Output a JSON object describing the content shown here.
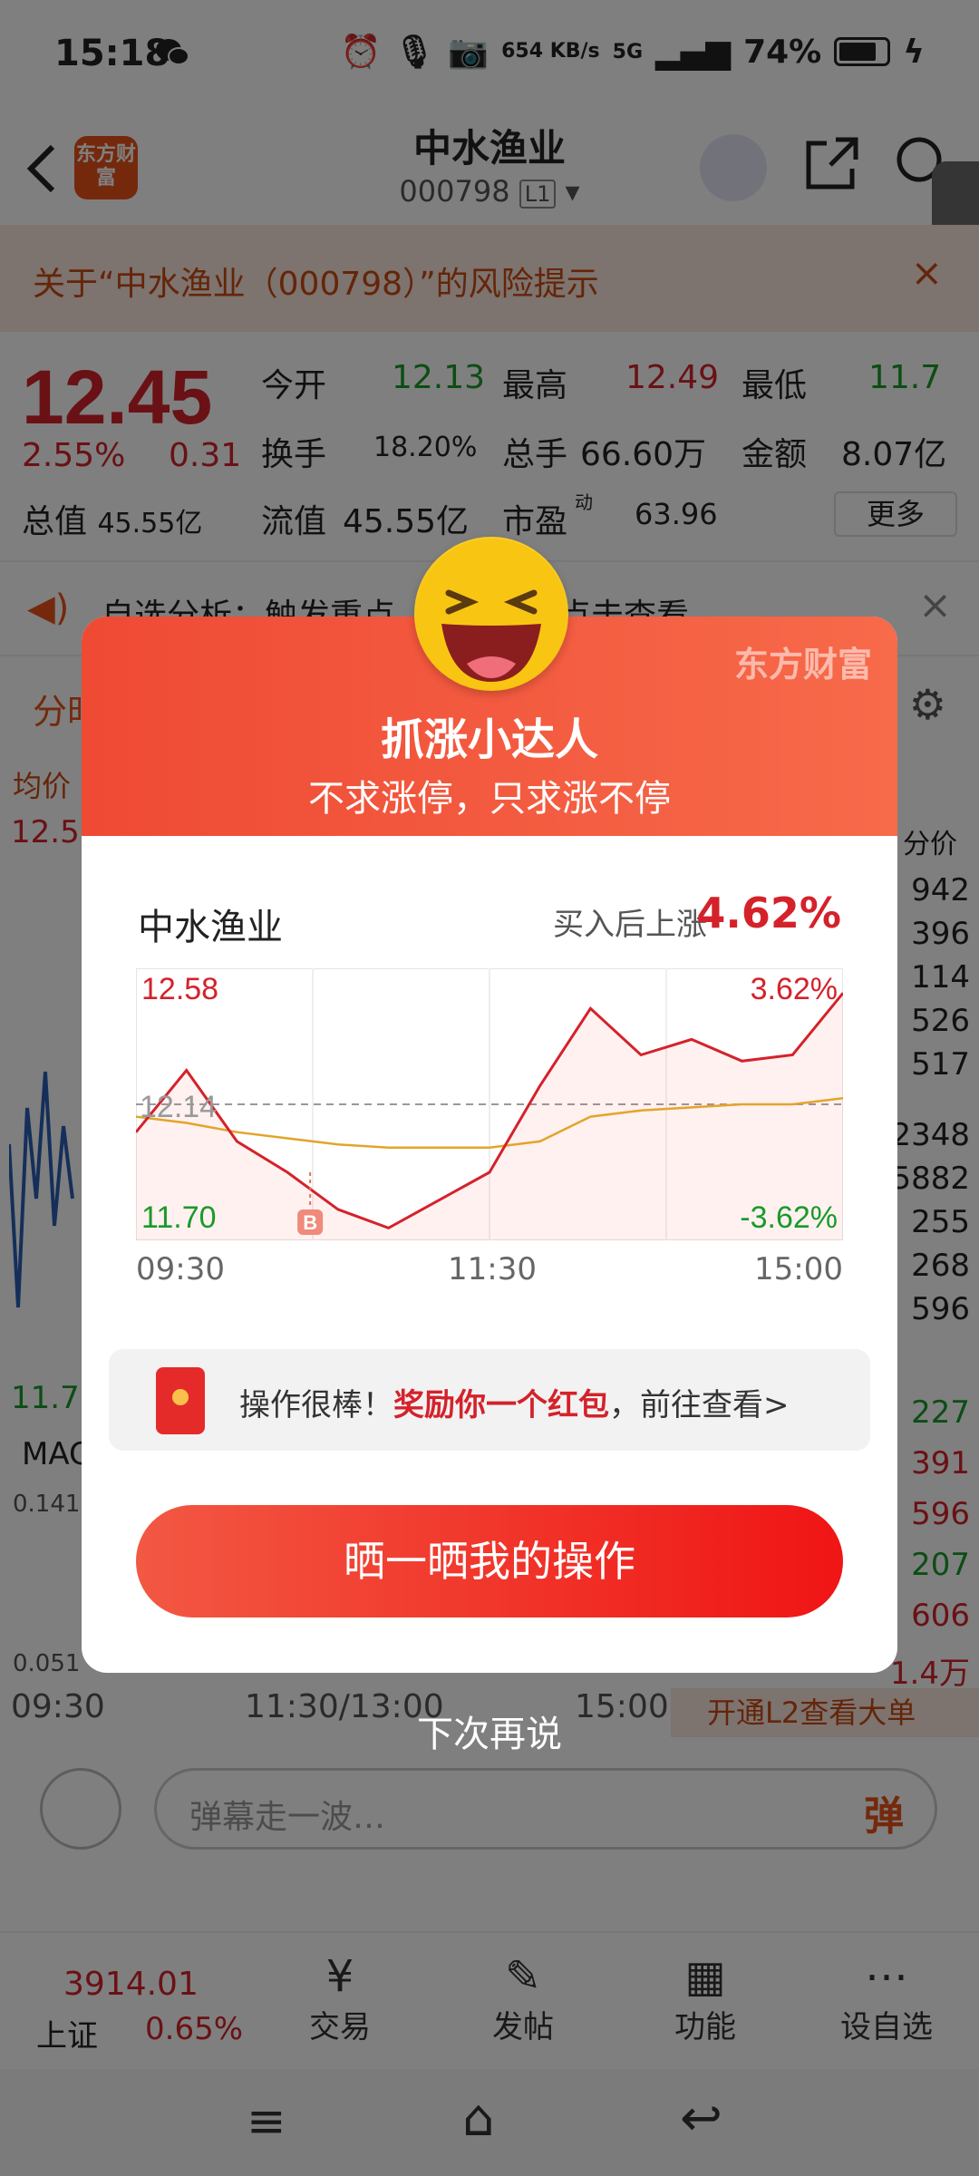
{
  "status_bar": {
    "time": "15:18",
    "net_speed": "654 KB/s",
    "network": "5G",
    "battery": "74%"
  },
  "header": {
    "logo": "东方财富",
    "title": "中水渔业",
    "code": "000798",
    "level": "L1"
  },
  "risk_notice": "关于“中水渔业（000798）”的风险提示",
  "quote": {
    "price": "12.45",
    "change_pct": "2.55%",
    "change": "0.31",
    "total_value_label": "总值",
    "total_value": "45.55亿",
    "open_label": "今开",
    "open": "12.13",
    "high_label": "最高",
    "high": "12.49",
    "low_label": "最低",
    "low": "11.7",
    "turnover_label": "换手",
    "turnover": "18.20%",
    "volume_label": "总手",
    "volume": "66.60万",
    "amount_label": "金额",
    "amount": "8.07亿",
    "float_label": "流值",
    "float_value": "45.55亿",
    "pe_label": "市盈",
    "pe_sup": "动",
    "pe": "63.96",
    "more": "更多"
  },
  "analysis_notice": "自选分析：触发重点……，立即点击查看",
  "tabs": {
    "intraday": "分时"
  },
  "chart_bg": {
    "avg_label": "均价",
    "top_price": "12.58",
    "bottom_price": "11.70",
    "macd_label": "MACD",
    "macd_top": "0.141",
    "macd_bottom": "0.051",
    "times": [
      "09:30",
      "11:30/13:00",
      "15:00"
    ],
    "side_header": "分价",
    "side_values": [
      "942",
      "396",
      "114",
      "526",
      "517",
      "2348",
      "5882",
      "255",
      "268",
      "596",
      "227",
      "391",
      "596",
      "207",
      "606",
      "1.4万"
    ],
    "l2_banner": "开通L2查看大单"
  },
  "danmu": {
    "placeholder": "弹幕走一波…",
    "send": "弹"
  },
  "bottom_nav": {
    "index_value": "3914.01",
    "index_name": "上证",
    "index_change": "0.65%",
    "items": [
      "交易",
      "发帖",
      "功能",
      "设自选"
    ]
  },
  "modal": {
    "watermark": "东方财富",
    "title": "抓涨小达人",
    "subtitle": "不求涨停，只求涨不停",
    "stock_name": "中水渔业",
    "rise_label": "买入后上涨",
    "rise_value": "4.62%",
    "chart": {
      "top_price": "12.58",
      "mid_price": "12.14",
      "bottom_price": "11.70",
      "top_pct": "3.62%",
      "bottom_pct": "-3.62%",
      "buy_marker": "B",
      "times": [
        "09:30",
        "11:30",
        "15:00"
      ]
    },
    "promo": {
      "prefix": "操作很棒！",
      "highlight": "奖励你一个红包",
      "suffix": "，前往查看>"
    },
    "share_button": "晒一晒我的操作",
    "later": "下次再说"
  },
  "chart_data": {
    "type": "line",
    "title": "",
    "x": [
      "09:30",
      "11:30",
      "15:00"
    ],
    "ylim": [
      11.7,
      12.58
    ],
    "reference": 12.14,
    "series": [
      {
        "name": "",
        "values": [
          12.05,
          12.25,
          12.02,
          11.92,
          11.8,
          11.74,
          11.83,
          11.92,
          12.2,
          12.45,
          12.3,
          12.35,
          12.28,
          12.3,
          12.5
        ]
      },
      {
        "name": "",
        "values": [
          12.1,
          12.08,
          12.05,
          12.03,
          12.01,
          12.0,
          12.0,
          12.0,
          12.02,
          12.1,
          12.12,
          12.13,
          12.14,
          12.14,
          12.16
        ]
      }
    ]
  }
}
